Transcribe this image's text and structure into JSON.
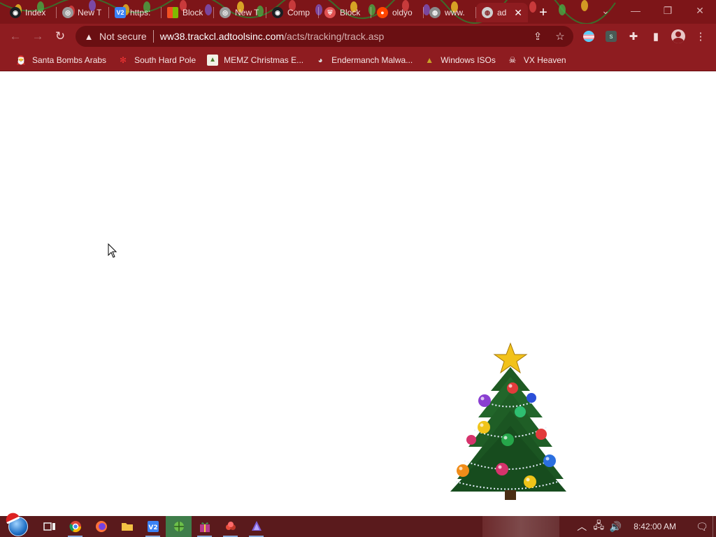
{
  "browser": {
    "tabs": [
      {
        "label": "Index",
        "icon": "github-icon",
        "color": "#ffffff"
      },
      {
        "label": "New T",
        "icon": "chrome-icon",
        "color": "#cccccc"
      },
      {
        "label": "https:",
        "icon": "v2-icon",
        "color": "#3b82f6"
      },
      {
        "label": "Block",
        "icon": "windows-icon",
        "color": "#e6e6e6"
      },
      {
        "label": "New T",
        "icon": "chrome-icon",
        "color": "#cccccc"
      },
      {
        "label": "Comp",
        "icon": "github-icon",
        "color": "#ffffff"
      },
      {
        "label": "Block",
        "icon": "shield-icon",
        "color": "#e05252"
      },
      {
        "label": "oldyo",
        "icon": "reddit-icon",
        "color": "#ff4500"
      },
      {
        "label": "www.",
        "icon": "globe-icon",
        "color": "#cccccc"
      },
      {
        "label": "ad",
        "icon": "globe-icon",
        "color": "#ffffff",
        "active": true
      }
    ],
    "new_tab_label": "+",
    "window_controls": {
      "tab_search": "⌄",
      "minimize": "—",
      "restore": "❐",
      "close": "✕"
    }
  },
  "toolbar": {
    "back": "←",
    "forward": "→",
    "reload": "↻",
    "security_label": "Not secure",
    "url_host": "ww38.trackcl.adtoolsinc.com",
    "url_path": "/acts/tracking/track.asp"
  },
  "bookmarks": [
    {
      "label": "Santa Bombs Arabs",
      "icon": "santa-icon"
    },
    {
      "label": "South Hard Pole",
      "icon": "snowflake-icon"
    },
    {
      "label": "MEMZ Christmas E...",
      "icon": "image-icon"
    },
    {
      "label": "Endermanch Malwa...",
      "icon": "raccoon-icon"
    },
    {
      "label": "Windows ISOs",
      "icon": "tree-icon"
    },
    {
      "label": "VX Heaven",
      "icon": "skull-icon"
    }
  ],
  "taskbar": {
    "items": [
      {
        "name": "task-view",
        "icon": "task-view-icon"
      },
      {
        "name": "chrome",
        "icon": "chrome-icon"
      },
      {
        "name": "firefox",
        "icon": "firefox-icon"
      },
      {
        "name": "file-explorer",
        "icon": "folder-icon"
      },
      {
        "name": "v2",
        "icon": "v2-icon"
      },
      {
        "name": "app-green",
        "icon": "globe-icon"
      },
      {
        "name": "app-purple",
        "icon": "gift-icon"
      },
      {
        "name": "app-red",
        "icon": "candy-icon"
      },
      {
        "name": "app-blue",
        "icon": "crystal-icon"
      }
    ],
    "clock": "8:42:00 AM"
  },
  "colors": {
    "tabstrip": "#7d1518",
    "toolbar": "#8e1c20",
    "omnibox": "#6a0f12",
    "taskbar": "#5a1a1c"
  }
}
